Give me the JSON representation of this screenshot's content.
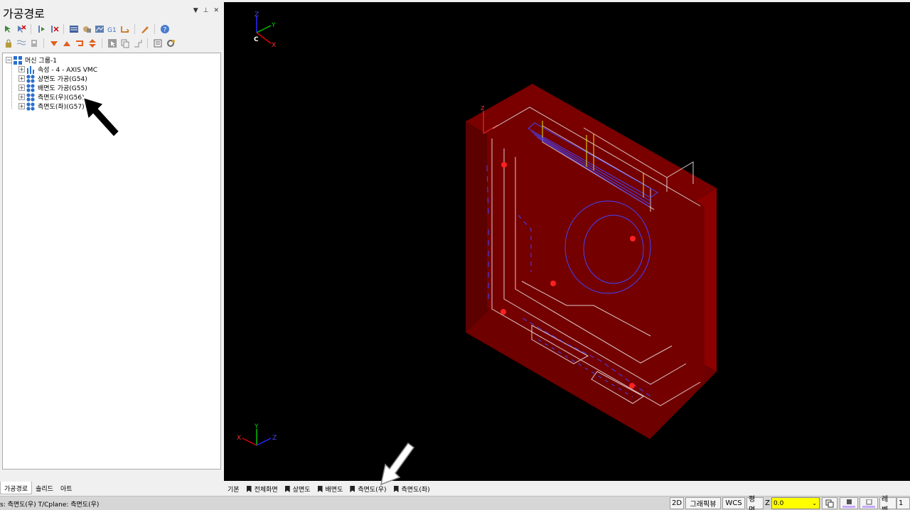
{
  "panel": {
    "title": "가공경로",
    "pin": "▾ ⊣ ✕"
  },
  "tree": {
    "root": "머신 그룹-1",
    "items": [
      {
        "label": "속성 - 4 - AXIS VMC"
      },
      {
        "label": "상면도 가공(G54)"
      },
      {
        "label": "배면도 가공(G55)"
      },
      {
        "label": "측면도(우)(G56)"
      },
      {
        "label": "측면도(좌)(G57)"
      }
    ]
  },
  "left_tabs": [
    "가공경로",
    "솔리드",
    "아트"
  ],
  "view_tabs": {
    "basic": "기본",
    "items": [
      "전체화면",
      "상면도",
      "배면도",
      "측면도(우)",
      "측면도(좌)"
    ]
  },
  "axes": {
    "z": "Z",
    "y": "Y",
    "x": "X",
    "c": "C"
  },
  "status": {
    "text": "s: 측면도(우)  T/Cplane: 측면도(우)",
    "mode_2d": "2D",
    "graphic_view": "그래픽뷰",
    "wcs": "WCS",
    "plane": "평면",
    "z_label": "Z",
    "z_value": "0.0",
    "level_label": "레벨",
    "level_value": "1"
  },
  "colors": {
    "part_front": "#6e0000",
    "part_top": "#8a0000",
    "part_side": "#a40000",
    "toolpath": "#3a3aff",
    "viewport_bg": "#000000",
    "z_field": "#ffff00"
  }
}
